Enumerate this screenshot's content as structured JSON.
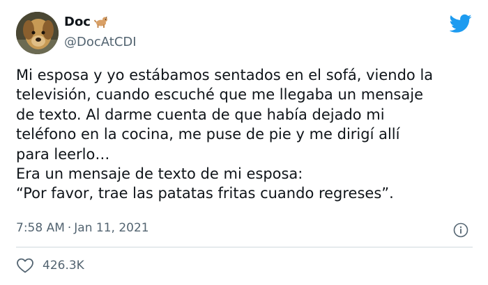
{
  "tweet": {
    "display_name": "Doc",
    "handle": "@DocAtCDI",
    "text": "Mi esposa y yo estábamos sentados en el sofá, viendo la\ntelevisión, cuando escuché que me llegaba un mensaje\nde texto. Al darme cuenta de que había dejado mi\nteléfono en la cocina, me puse de pie y me dirigí allí\npara leerlo…\nEra un mensaje de texto de mi esposa:\n“Por favor, trae las patatas fritas cuando regreses”.",
    "time": "7:58 AM",
    "separator": "·",
    "date": "Jan 11, 2021",
    "like_count": "426.3K"
  },
  "icons": {
    "avatar": "dog-photo",
    "name_emoji": "dog-emoji",
    "brand": "twitter-bird-icon",
    "info": "info-icon",
    "like": "heart-icon"
  },
  "colors": {
    "brand": "#1d9bf0",
    "text_primary": "#0f1419",
    "text_secondary": "#536471",
    "divider": "#cfd9de"
  }
}
